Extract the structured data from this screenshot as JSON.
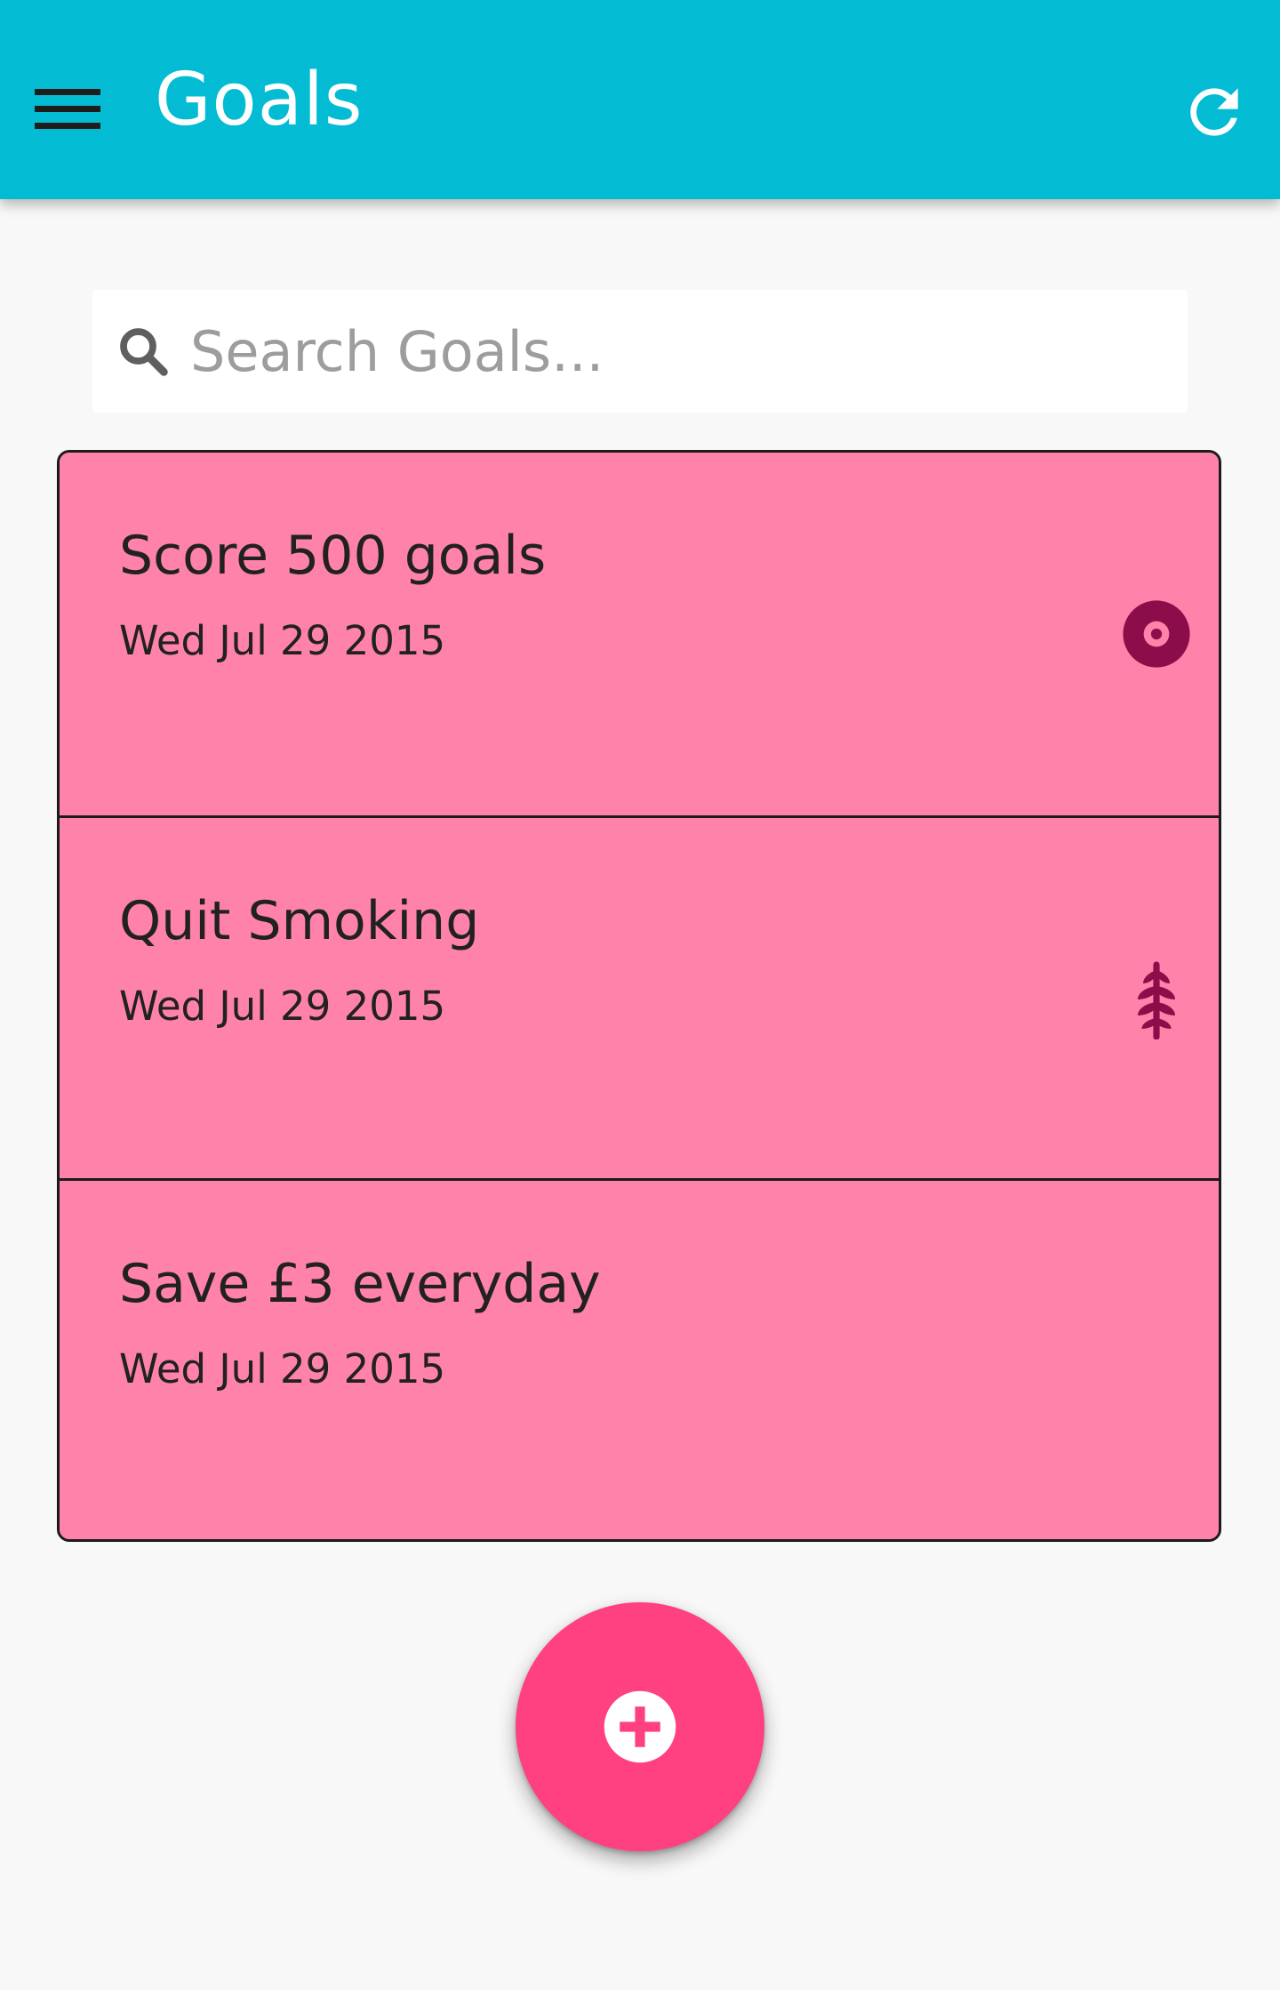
{
  "app_bar": {
    "title": "Goals",
    "background": "#03bcd4",
    "menu_icon": "hamburger-menu-icon",
    "refresh_icon": "refresh-icon"
  },
  "search": {
    "placeholder": "Search Goals...",
    "value": "",
    "icon": "search-icon"
  },
  "goals": [
    {
      "title": "Score 500 goals",
      "date": "Wed Jul 29 2015",
      "icon": "target-icon"
    },
    {
      "title": "Quit Smoking",
      "date": "Wed Jul 29 2015",
      "icon": "wheat-icon"
    },
    {
      "title": "Save £3 everyday",
      "date": "Wed Jul 29 2015",
      "icon": ""
    }
  ],
  "colors": {
    "card_background": "#ff82aa",
    "icon_color": "#8b0e4a",
    "fab_background": "#ff4081",
    "page_background": "#f8f8f8"
  },
  "fab": {
    "icon": "add-circle-icon"
  }
}
